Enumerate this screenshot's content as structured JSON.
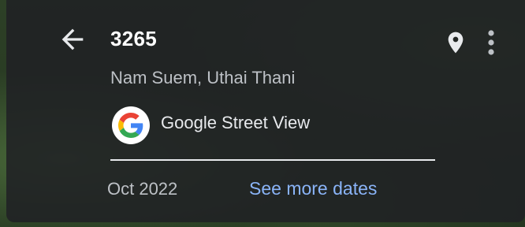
{
  "header": {
    "title": "3265",
    "subtitle": "Nam Suem, Uthai Thani"
  },
  "provider": {
    "name": "Google Street View"
  },
  "footer": {
    "date": "Oct 2022",
    "see_more_label": "See more dates"
  },
  "colors": {
    "link": "#8ab4f8",
    "panel_bg": "#202124",
    "text_primary": "#ffffff",
    "text_secondary": "#bdc1c6"
  },
  "icons": {
    "back": "arrow-back-icon",
    "pin": "map-pin-icon",
    "more": "more-vert-icon",
    "logo": "google-g-logo"
  }
}
